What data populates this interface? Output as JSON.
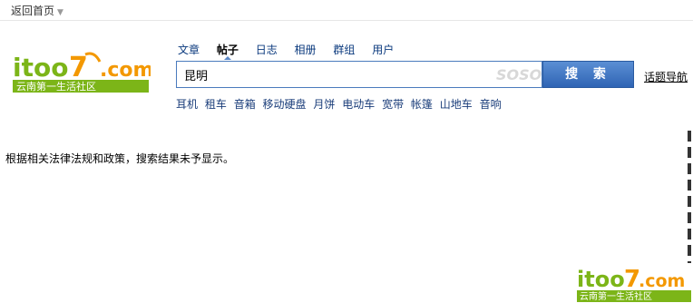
{
  "header": {
    "back_home": "返回首页"
  },
  "logo": {
    "brand": "itoo7.com",
    "slogan": "云南第一生活社区",
    "accent_color": "#f39800",
    "green_color": "#7cb518"
  },
  "search": {
    "tabs": [
      {
        "label": "文章"
      },
      {
        "label": "帖子",
        "active": true
      },
      {
        "label": "日志"
      },
      {
        "label": "相册"
      },
      {
        "label": "群组"
      },
      {
        "label": "用户"
      }
    ],
    "query": "昆明",
    "watermark": "SOSO",
    "button_label": "搜 索",
    "topic_nav": "话题导航",
    "hotwords": [
      "耳机",
      "租车",
      "音箱",
      "移动硬盘",
      "月饼",
      "电动车",
      "宽带",
      "帐篷",
      "山地车",
      "音响"
    ]
  },
  "main": {
    "notice": "根据相关法律法规和政策，搜索结果未予显示。"
  },
  "colors": {
    "button": "#3a6fbf",
    "link": "#0b3a7e"
  }
}
